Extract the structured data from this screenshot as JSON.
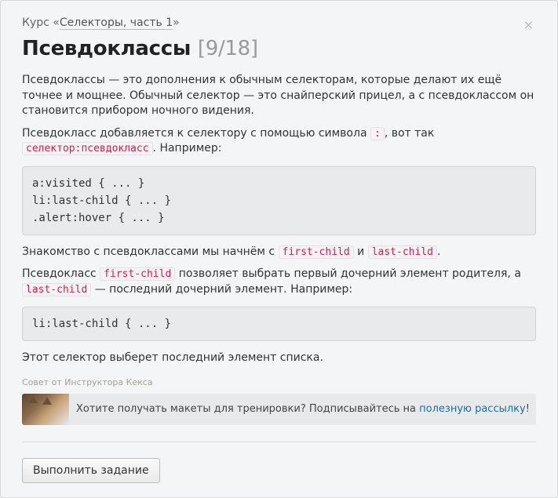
{
  "header": {
    "course_prefix": "Курс «",
    "course_link": "Селекторы, часть 1",
    "course_suffix": "»",
    "close_glyph": "×",
    "title": "Псевдоклассы",
    "counter": "[9/18]"
  },
  "content": {
    "p1": "Псевдоклассы — это дополнения к обычным селекторам, которые делают их ещё точнее и мощнее. Обычный селектор — это снайперский прицел, а с псевдоклассом он становится прибором ночного видения.",
    "p2_a": "Псевдокласс добавляется к селектору с помощью символа ",
    "p2_code1": ":",
    "p2_b": ", вот так ",
    "p2_code2": "селектор:псевдокласс",
    "p2_c": ". Например:",
    "code_block_1": "a:visited { ... }\nli:last-child { ... }\n.alert:hover { ... }",
    "p3_a": "Знакомство с псевдоклассами мы начнём с ",
    "p3_code1": "first-child",
    "p3_b": " и ",
    "p3_code2": "last-child",
    "p3_c": ".",
    "p4_a": "Псевдокласс ",
    "p4_code1": "first-child",
    "p4_b": " позволяет выбрать первый дочерний элемент родителя, а ",
    "p4_code2": "last-child",
    "p4_c": " — последний дочерний элемент. Например:",
    "code_block_2": "li:last-child { ... }",
    "p5": "Этот селектор выберет последний элемент списка."
  },
  "tip": {
    "label": "Совет от Инструктора Кекса",
    "text_before": "Хотите получать макеты для тренировки? Подписывайтесь на ",
    "link": "полезную рассылку",
    "text_after": "!"
  },
  "actions": {
    "submit_label": "Выполнить задание"
  }
}
